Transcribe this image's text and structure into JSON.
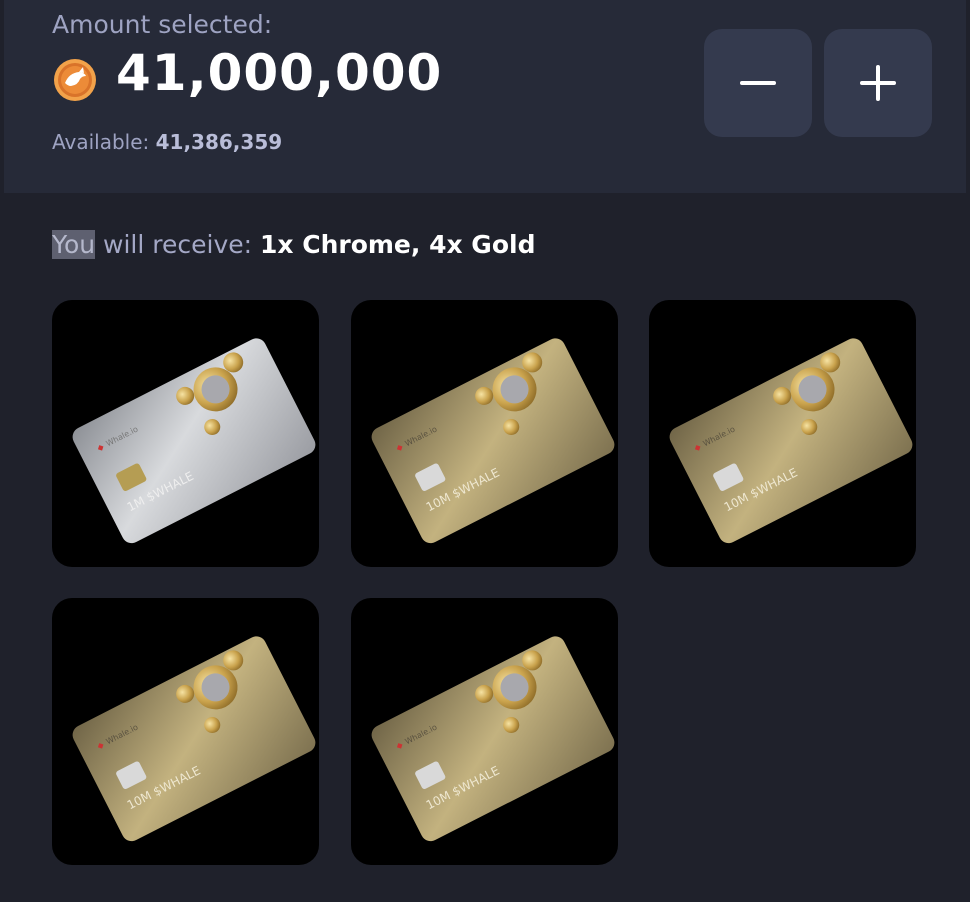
{
  "header": {
    "amount_label": "Amount selected:",
    "amount_value": "41,000,000",
    "available_label": "Available:",
    "available_value": "41,386,359"
  },
  "controls": {
    "decrease_symbol": "−",
    "increase_symbol": "+"
  },
  "receive": {
    "prefix_highlight": "You",
    "prefix_rest": " will receive: ",
    "summary": "1x Chrome, 4x Gold"
  },
  "cards": [
    {
      "tier": "Chrome",
      "brand": "Whale.io",
      "denomination": "1M $WHALE"
    },
    {
      "tier": "Gold",
      "brand": "Whale.io",
      "denomination": "10M $WHALE"
    },
    {
      "tier": "Gold",
      "brand": "Whale.io",
      "denomination": "10M $WHALE"
    },
    {
      "tier": "Gold",
      "brand": "Whale.io",
      "denomination": "10M $WHALE"
    },
    {
      "tier": "Gold",
      "brand": "Whale.io",
      "denomination": "10M $WHALE"
    }
  ],
  "colors": {
    "background": "#1f212b",
    "panel": "#262a38",
    "button": "#343a4e",
    "chrome_card": "#c9cbd0",
    "gold_card": "#b6a577",
    "coin": "#e27f2d"
  }
}
